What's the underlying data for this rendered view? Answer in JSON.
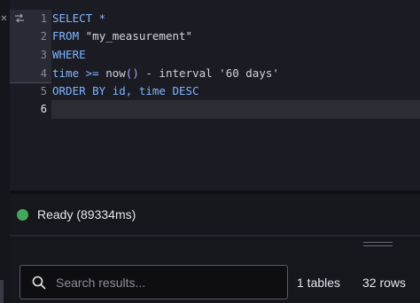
{
  "editor": {
    "lines": [
      {
        "num": "1",
        "tokens": [
          {
            "t": "SELECT *",
            "c": "kw"
          }
        ]
      },
      {
        "num": "2",
        "tokens": [
          {
            "t": "FROM ",
            "c": "kw"
          },
          {
            "t": "\"my_measurement\"",
            "c": "str"
          }
        ]
      },
      {
        "num": "3",
        "tokens": [
          {
            "t": "WHERE",
            "c": "kw"
          }
        ]
      },
      {
        "num": "4",
        "tokens": [
          {
            "t": "time >= ",
            "c": "kw"
          },
          {
            "t": "now",
            "c": "plain"
          },
          {
            "t": "()",
            "c": "fn"
          },
          {
            "t": " - interval '60 days'",
            "c": "plain"
          }
        ]
      },
      {
        "num": "5",
        "tokens": [
          {
            "t": "ORDER BY id, time DESC",
            "c": "kw"
          }
        ]
      },
      {
        "num": "6",
        "tokens": []
      }
    ],
    "current_line": "6"
  },
  "status": {
    "text": "Ready (89334ms)",
    "dot_color": "#46a75a"
  },
  "results": {
    "search_placeholder": "Search results...",
    "search_value": "",
    "tables_count": "1 tables",
    "rows_count": "32 rows"
  },
  "colors": {
    "keyword": "#7fb6ff",
    "accent_green": "#46a75a",
    "background": "#0f0f14"
  },
  "icons": {
    "close": "close-icon",
    "wrap": "line-wrap-icon",
    "search": "search-icon",
    "handle": "drag-handle-icon"
  }
}
